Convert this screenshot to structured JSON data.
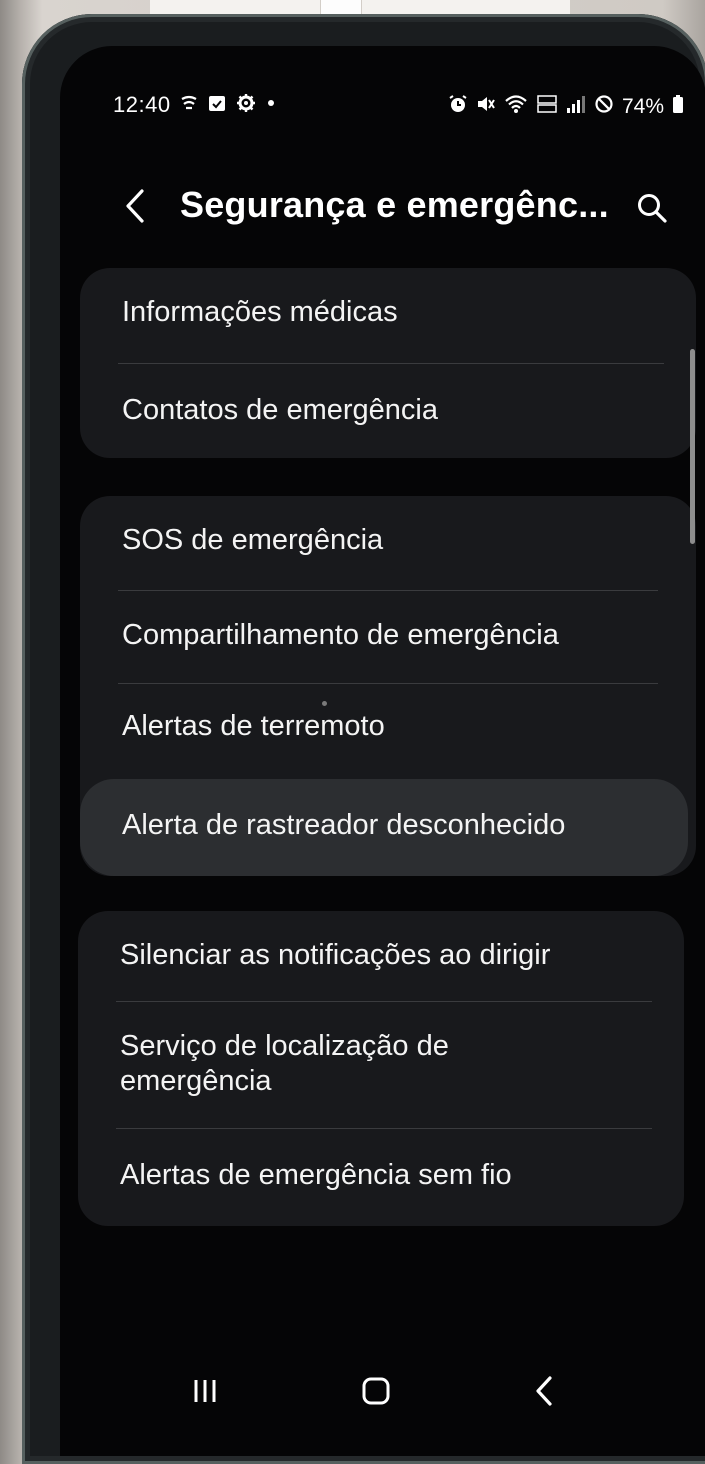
{
  "status_bar": {
    "time": "12:40",
    "battery": "74%",
    "left_icons": [
      "notification-icon",
      "calendar-icon",
      "settings-icon",
      "dot-icon"
    ],
    "right_icons": [
      "alarm-icon",
      "mute-icon",
      "wifi-icon",
      "volte-icon",
      "signal-icon",
      "blocked-icon",
      "battery-icon"
    ]
  },
  "header": {
    "title": "Segurança e emergênc...",
    "back_icon": "chevron-left-icon",
    "search_icon": "search-icon"
  },
  "groups": [
    {
      "items": [
        {
          "label": "Informações médicas"
        },
        {
          "label": "Contatos de emergência"
        }
      ]
    },
    {
      "items": [
        {
          "label": "SOS de emergência"
        },
        {
          "label": "Compartilhamento de emergência"
        },
        {
          "label": "Alertas de terremoto"
        },
        {
          "label": "Alerta de rastreador desconhecido"
        }
      ]
    },
    {
      "items": [
        {
          "label": "Silenciar as notificações ao dirigir"
        },
        {
          "label": "Serviço de localização de",
          "label_line2": "emergência"
        },
        {
          "label": "Alertas de emergência sem fio"
        }
      ]
    }
  ],
  "nav_bar": {
    "recents_icon": "recents-icon",
    "home_icon": "home-icon",
    "back_icon": "back-icon"
  },
  "colors": {
    "screen_bg": "#050506",
    "card_bg": "#18191c",
    "highlight_bg": "#2c2e31",
    "text": "#f4f4f4"
  }
}
